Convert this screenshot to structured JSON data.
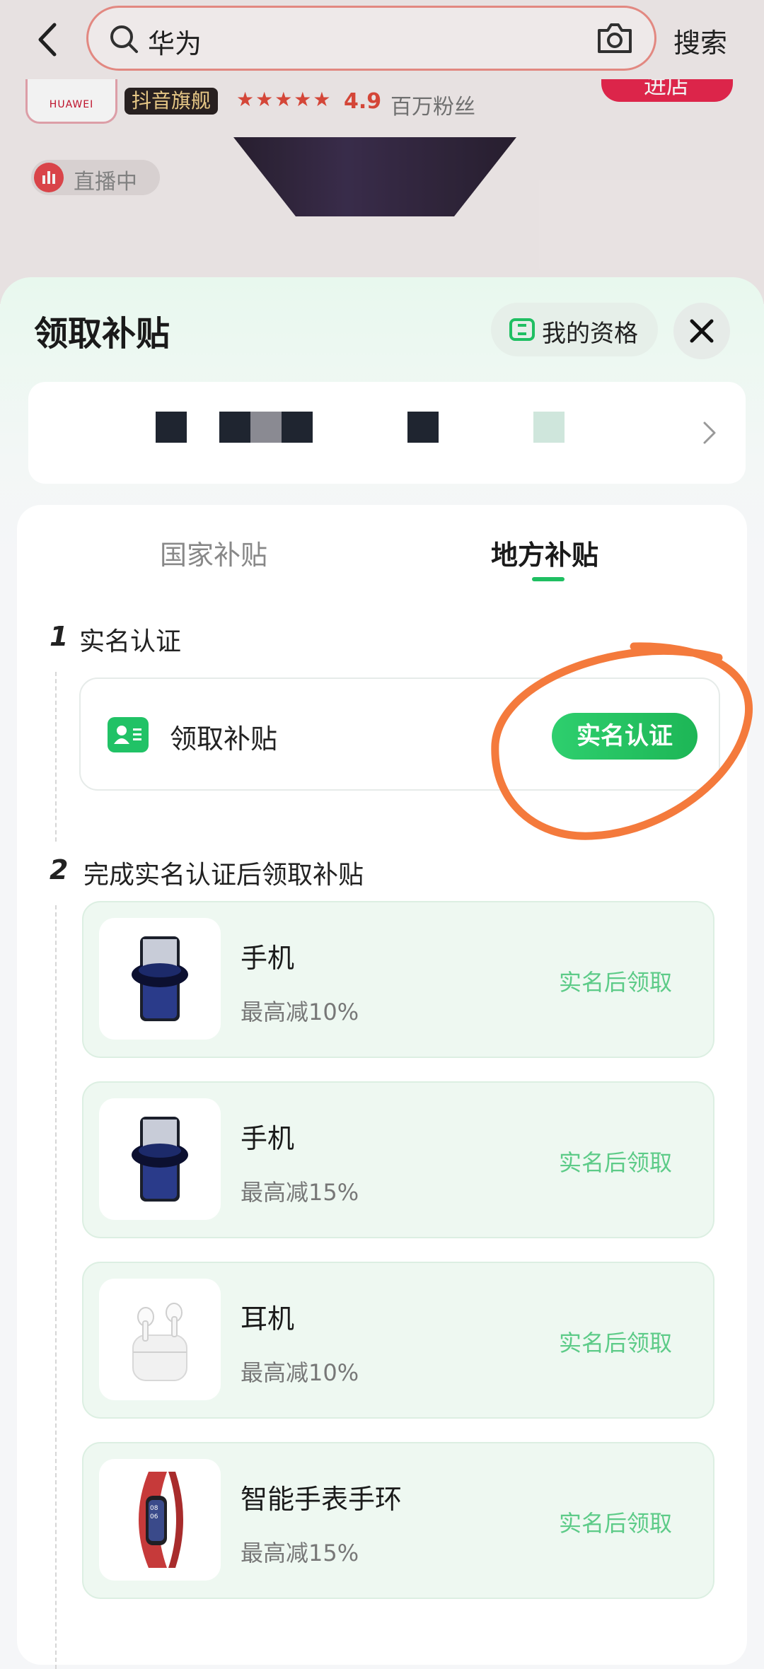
{
  "topbar": {
    "search_value": "华为",
    "search_button": "搜索"
  },
  "store": {
    "logo_text": "HUAWEI",
    "badge": "抖音旗舰",
    "stars": "★★★★★",
    "rating": "4.9",
    "fans": "百万粉丝",
    "enter_label": "进店",
    "live_label": "直播中"
  },
  "sheet": {
    "title": "领取补贴",
    "qualification_label": "我的资格",
    "tabs": [
      {
        "label": "国家补贴",
        "active": false
      },
      {
        "label": "地方补贴",
        "active": true
      }
    ],
    "step1": {
      "number": "1",
      "title": "实名认证",
      "row_label": "领取补贴",
      "button_label": "实名认证"
    },
    "step2": {
      "number": "2",
      "title": "完成实名认证后领取补贴",
      "items": [
        {
          "name": "手机",
          "desc": "最高减10%",
          "action": "实名后领取",
          "icon": "phone-image"
        },
        {
          "name": "手机",
          "desc": "最高减15%",
          "action": "实名后领取",
          "icon": "phone-image"
        },
        {
          "name": "耳机",
          "desc": "最高减10%",
          "action": "实名后领取",
          "icon": "earbuds-image"
        },
        {
          "name": "智能手表手环",
          "desc": "最高减15%",
          "action": "实名后领取",
          "icon": "smart-band-image"
        }
      ]
    }
  },
  "colors": {
    "accent_green": "#1fbf62",
    "annotation_orange": "#f47a3c",
    "action_text": "#5dcb88"
  }
}
